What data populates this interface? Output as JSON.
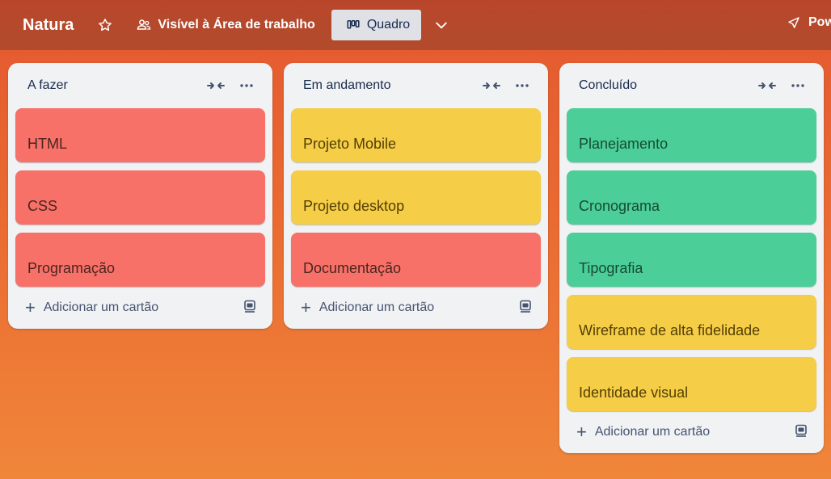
{
  "header": {
    "board_title": "Natura",
    "visibility_label": "Visível à Área de trabalho",
    "view_label": "Quadro",
    "power_label": "Pow",
    "icons": [
      "star-icon",
      "people-icon",
      "board-view-icon",
      "chevron-down-icon",
      "rocket-icon"
    ]
  },
  "lists": [
    {
      "title": "A fazer",
      "cards": [
        {
          "label": "HTML",
          "color": "red"
        },
        {
          "label": "CSS",
          "color": "red"
        },
        {
          "label": "Programação",
          "color": "red"
        }
      ],
      "add_label": "Adicionar um cartão"
    },
    {
      "title": "Em andamento",
      "cards": [
        {
          "label": "Projeto Mobile",
          "color": "yellow"
        },
        {
          "label": "Projeto desktop",
          "color": "yellow"
        },
        {
          "label": "Documentação",
          "color": "red"
        }
      ],
      "add_label": "Adicionar um cartão"
    },
    {
      "title": "Concluído",
      "cards": [
        {
          "label": "Planejamento",
          "color": "green"
        },
        {
          "label": "Cronograma",
          "color": "green"
        },
        {
          "label": "Tipografia",
          "color": "green"
        },
        {
          "label": "Wireframe de alta fidelidade",
          "color": "yellow"
        },
        {
          "label": "Identidade visual",
          "color": "yellow"
        }
      ],
      "add_label": "Adicionar um cartão"
    }
  ],
  "colors": {
    "red": "#f87168",
    "yellow": "#f5cd47",
    "green": "#4bce97",
    "header_bg": "#b9462b",
    "board_bg": "#ea6a31"
  }
}
